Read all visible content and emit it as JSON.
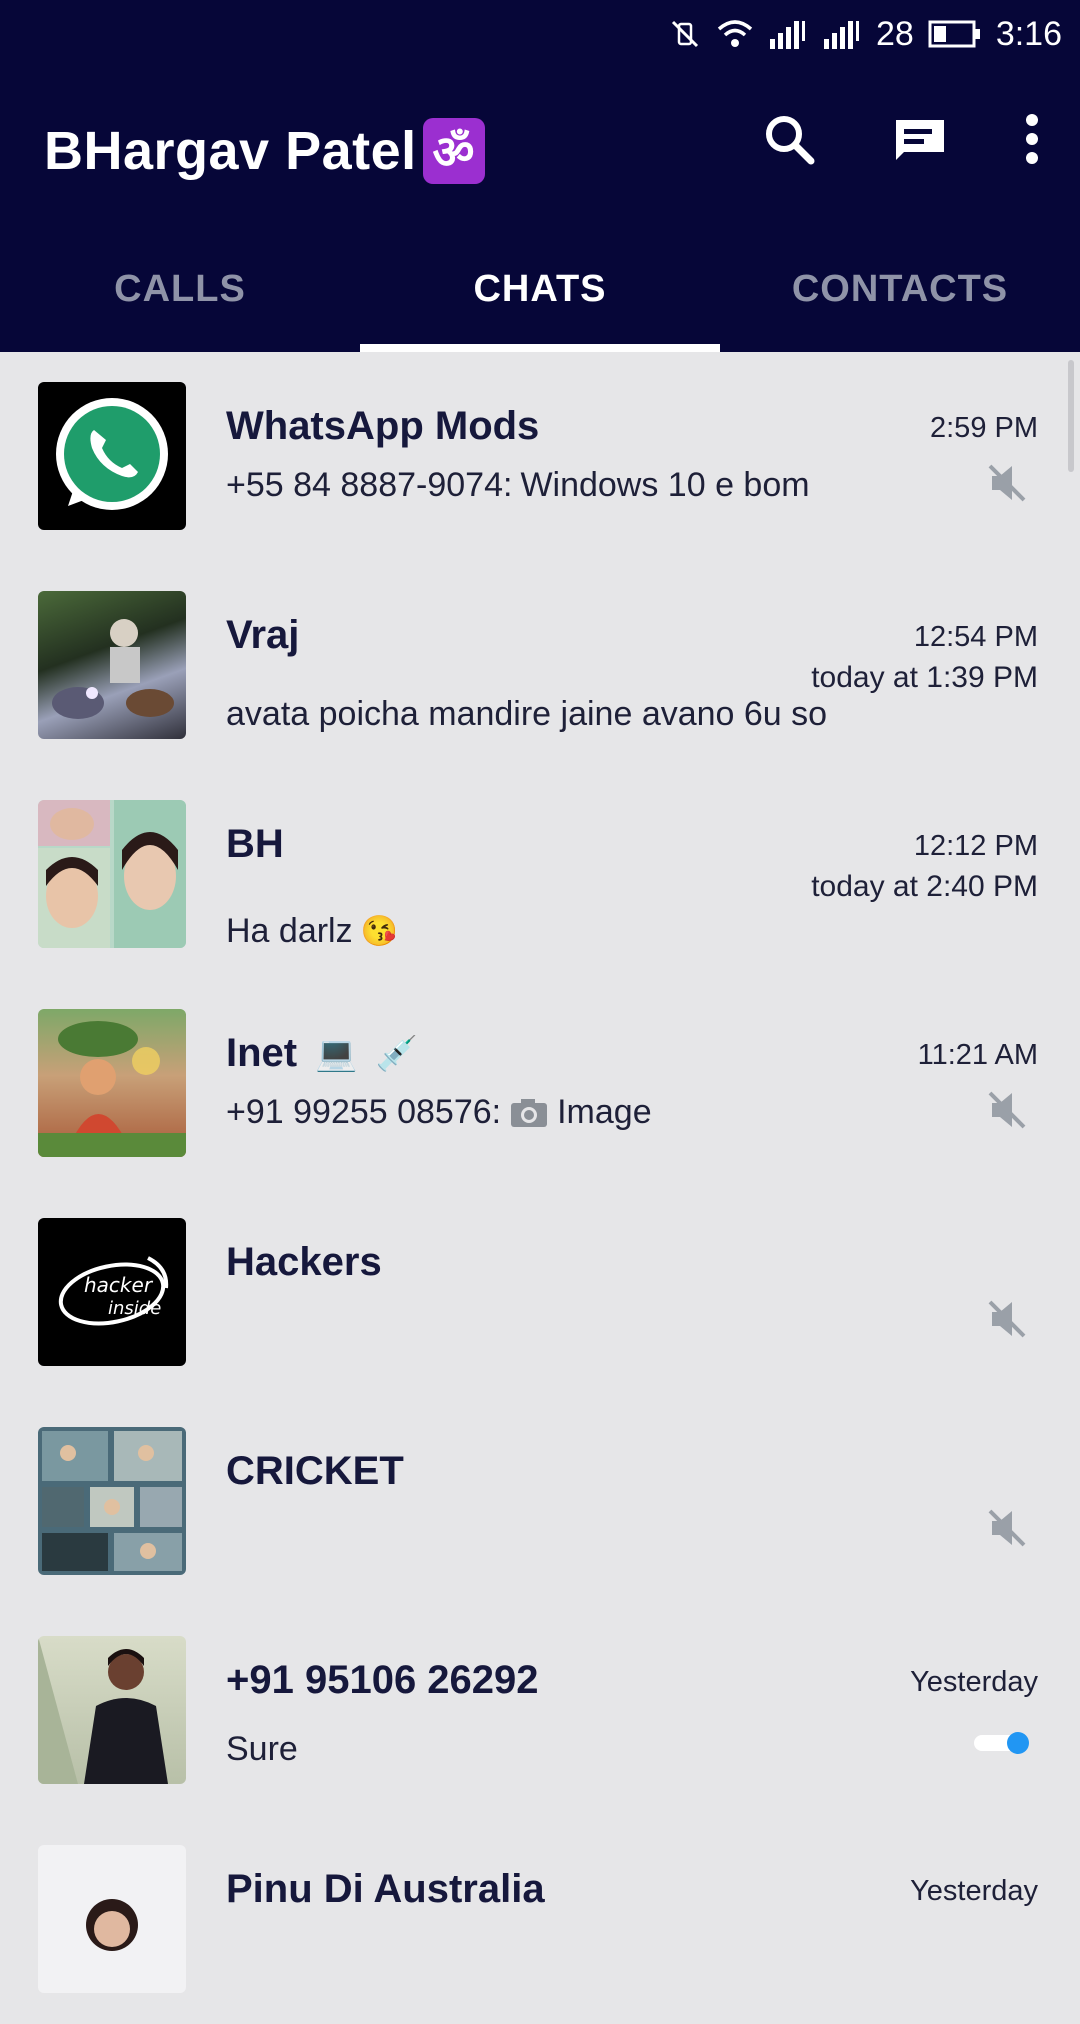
{
  "status_bar": {
    "signal_text": "28",
    "time": "3:16"
  },
  "app_bar": {
    "title": "BHargav Patel",
    "title_emoji": "ॐ"
  },
  "tabs": [
    {
      "label": "CALLS",
      "active": false
    },
    {
      "label": "CHATS",
      "active": true
    },
    {
      "label": "CONTACTS",
      "active": false
    }
  ],
  "chats": [
    {
      "name": "WhatsApp Mods",
      "sender": "+55 84 8887-9074:",
      "message": "Windows 10 e bom",
      "time": "2:59 PM",
      "muted": true,
      "avatar": "whatsapp-logo"
    },
    {
      "name": "Vraj",
      "message": "avata poicha mandire jaine avano 6u so",
      "time": "12:54 PM",
      "last_seen": "today at 1:39 PM",
      "avatar": "photo-bike"
    },
    {
      "name": "BH",
      "message": "Ha darlz",
      "message_emoji": "😘",
      "time": "12:12 PM",
      "last_seen": "today at 2:40 PM",
      "avatar": "photo-girls"
    },
    {
      "name": "Inet",
      "name_emoji_1": "💻",
      "name_emoji_2": "💉",
      "sender": "+91 99255 08576:",
      "message": "Image",
      "time": "11:21 AM",
      "muted": true,
      "avatar": "photo-god"
    },
    {
      "name": "Hackers",
      "muted": true,
      "avatar": "hacker-inside",
      "avatar_text_1": "hacker",
      "avatar_text_2": "inside"
    },
    {
      "name": "CRICKET",
      "muted": true,
      "avatar": "photo-group"
    },
    {
      "name": "+91 95106 26292",
      "message": "Sure",
      "time": "Yesterday",
      "avatar": "photo-man",
      "toggle_on": true
    },
    {
      "name": "Pinu Di Australia",
      "time": "Yesterday",
      "avatar": "photo-woman"
    }
  ],
  "colors": {
    "header_bg": "#060638",
    "list_bg": "#e6e6e8",
    "accent_toggle": "#2196f3"
  }
}
